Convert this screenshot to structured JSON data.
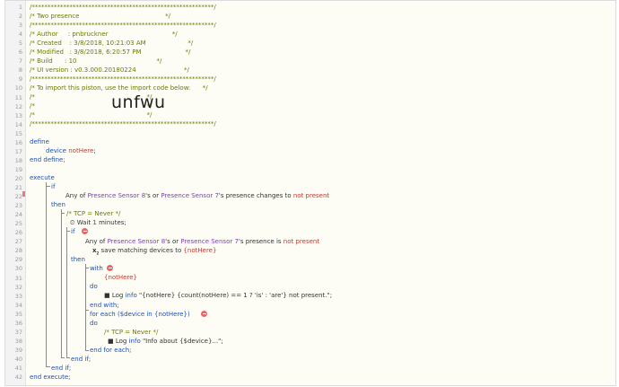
{
  "gutter_numbers": [
    "1",
    "2",
    "3",
    "4",
    "5",
    "6",
    "7",
    "8",
    "9",
    "10",
    "11",
    "12",
    "13",
    "14",
    "15",
    "16",
    "17",
    "18",
    "19",
    "20",
    "21",
    "22",
    "23",
    "24",
    "25",
    "26",
    "27",
    "28",
    "29",
    "30",
    "31",
    "32",
    "33",
    "34",
    "35",
    "36",
    "37",
    "38",
    "39",
    "40",
    "41",
    "42"
  ],
  "header": {
    "stars": "/**********************************************************/",
    "title": "/* Two presence                                           */",
    "author": "/* Author     : pnbruckner                                */",
    "created": "/* Created    : 3/8/2018, 10:21:03 AM                     */",
    "modified": "/* Modified   : 3/8/2018, 6:20:57 PM                      */",
    "build": "/* Build      : 10                                        */",
    "ui_version": "/* UI version : v0.3.000.20180224                        */",
    "import_hint": "/* To import this piston, use the import code below:      */",
    "blank": "/*                                                        */",
    "import_code": "unfwu"
  },
  "code": {
    "define": "define",
    "device_kw": "device",
    "device_var": "notHere",
    "semicolon": ";",
    "end_define": "end define;",
    "execute": "execute",
    "if": "if",
    "any_of": "Any of ",
    "sensor_8": "Presence Sensor 8",
    "apos_s_or": "'s or ",
    "sensor_7": "Presence Sensor 7",
    "presence_changes": "'s presence changes to ",
    "not_present": "not present",
    "then": "then",
    "tcp_never": "/* TCP = Never */",
    "wait_text": "Wait ",
    "wait_num": "1",
    "wait_unit": " minutes;",
    "presence_is": "'s presence is ",
    "save_matching": "save matching devices to ",
    "not_here_braced": "{notHere}",
    "with": "with",
    "do": "do",
    "log": "Log ",
    "info": "info",
    "log_msg_1": " \"{notHere} {count(notHere) == 1 ? 'is' : 'are'} not present.\";",
    "end_with": "end with;",
    "for_each": "for each ($device in {notHere})",
    "log_msg_2": " \"Info about {$device}...\";",
    "end_for_each": "end for each;",
    "end_if": "end if;",
    "end_execute": "end execute;"
  },
  "colors": {
    "comment": "#6b7a00",
    "keyword": "#1c4fb8",
    "device": "#7a3fb3",
    "variable": "#c0392b"
  }
}
